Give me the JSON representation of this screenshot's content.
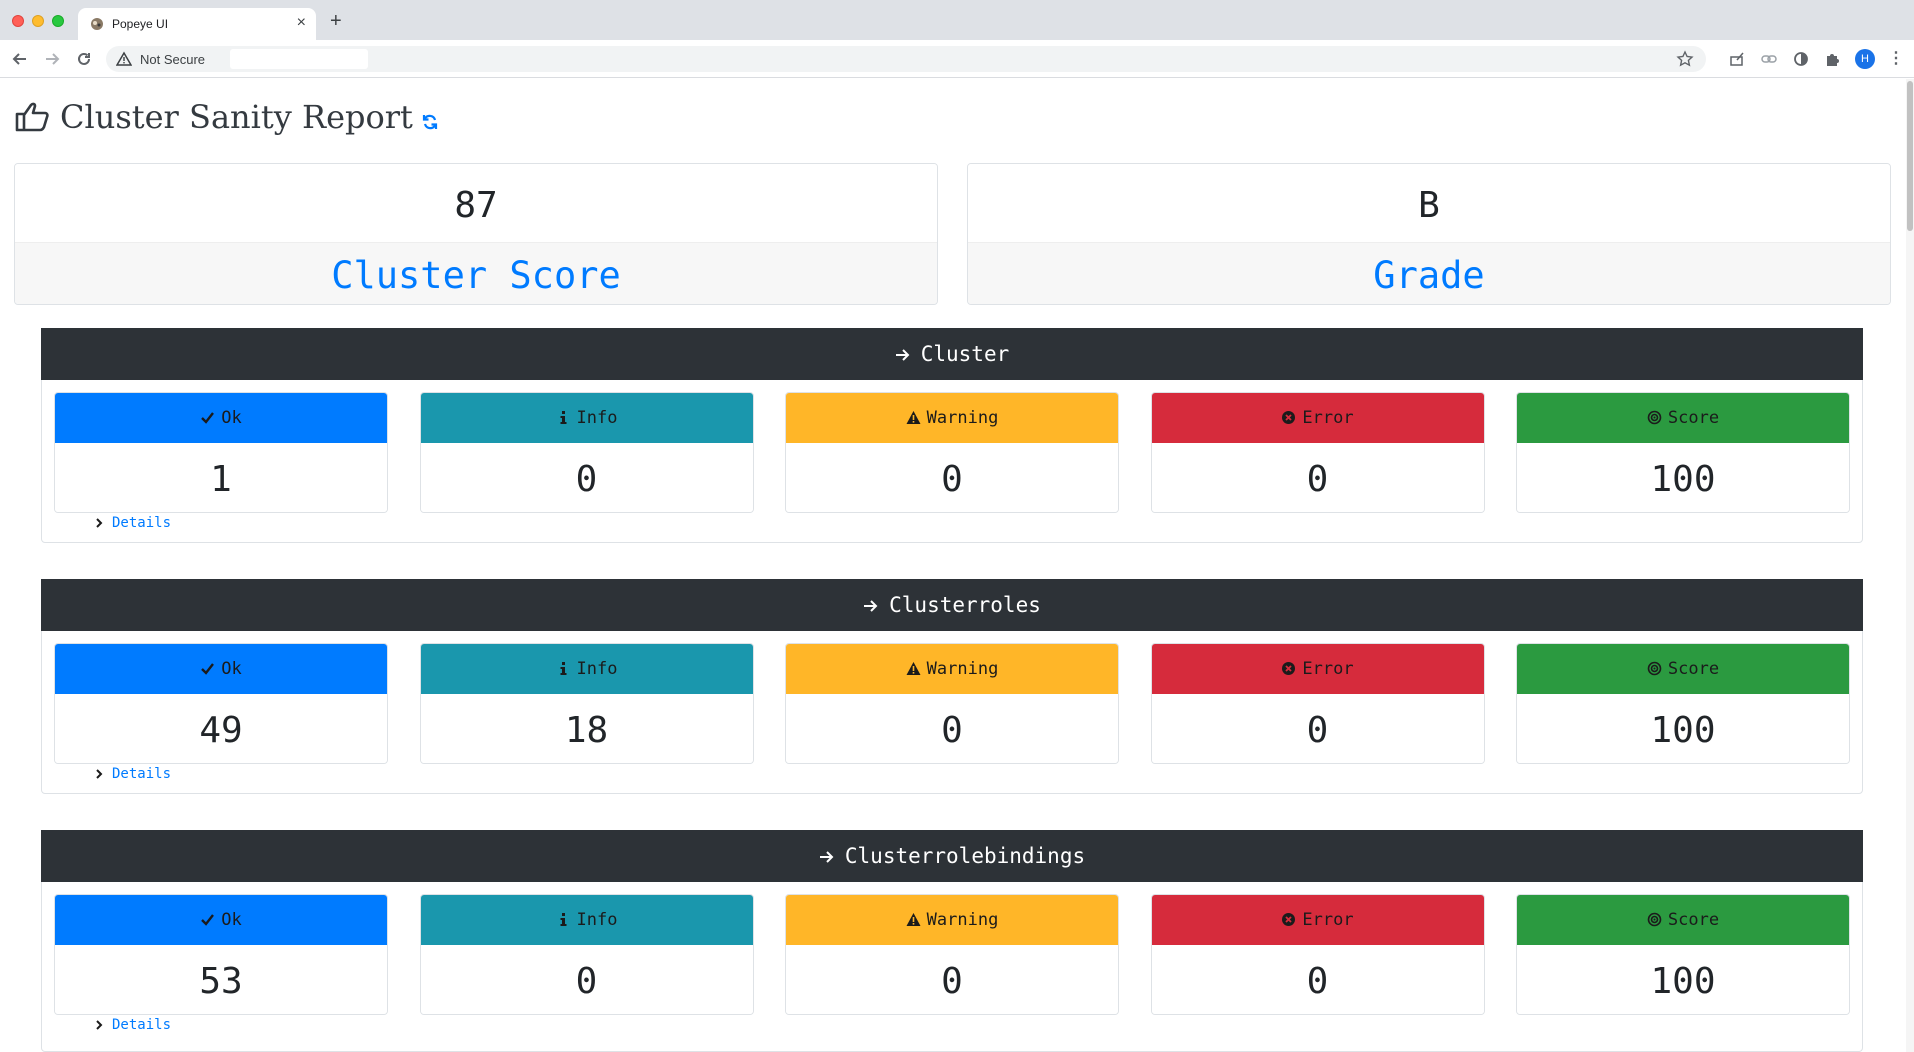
{
  "browser": {
    "tab_title": "Popeye UI",
    "tab_close": "×",
    "new_tab": "+",
    "security_label": "Not Secure",
    "profile_initial": "H",
    "menu": "⋮"
  },
  "page": {
    "title": "Cluster Sanity Report"
  },
  "summary": {
    "score_value": "87",
    "score_label": "Cluster Score",
    "grade_value": "B",
    "grade_label": "Grade"
  },
  "card_labels": {
    "ok": "Ok",
    "info": "Info",
    "warning": "Warning",
    "error": "Error",
    "score": "Score"
  },
  "sections": [
    {
      "name": "Cluster",
      "ok": "1",
      "info": "0",
      "warning": "0",
      "error": "0",
      "score": "100",
      "details": "Details"
    },
    {
      "name": "Clusterroles",
      "ok": "49",
      "info": "18",
      "warning": "0",
      "error": "0",
      "score": "100",
      "details": "Details"
    },
    {
      "name": "Clusterrolebindings",
      "ok": "53",
      "info": "0",
      "warning": "0",
      "error": "0",
      "score": "100",
      "details": "Details"
    }
  ],
  "colors": {
    "ok": "#007bff",
    "info": "#1a97ad",
    "warning": "#ffb628",
    "error": "#d62b3c",
    "score": "#2b9a40",
    "header": "#2d3237",
    "link": "#007bff"
  }
}
